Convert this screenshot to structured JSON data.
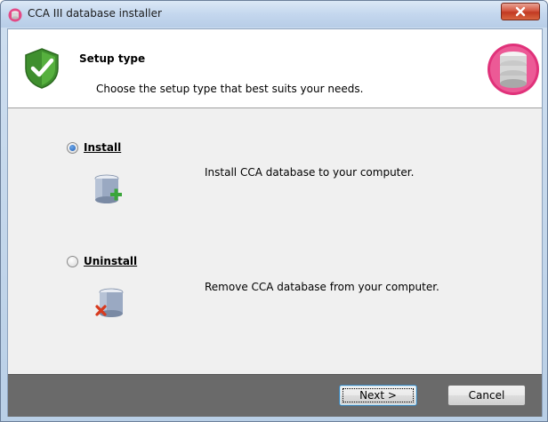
{
  "window": {
    "title": "CCA III database installer",
    "icons": {
      "app": "database-app-icon",
      "close": "close-icon"
    }
  },
  "header": {
    "title": "Setup type",
    "description": "Choose the setup type that best suits your needs.",
    "icons": {
      "left": "green-shield-check-icon",
      "right": "database-logo-icon"
    }
  },
  "options": [
    {
      "label": "Install",
      "mnemonic": "I",
      "description": "Install CCA database to your computer.",
      "selected": true,
      "icon": "database-add-icon"
    },
    {
      "label": "Uninstall",
      "mnemonic": "U",
      "description": "Remove CCA database from your computer.",
      "selected": false,
      "icon": "database-remove-icon"
    }
  ],
  "footer": {
    "next_label": "Next >",
    "cancel_label": "Cancel"
  },
  "colors": {
    "footer_bg": "#6a6a6a",
    "close_button": "#c23a22",
    "accent": "#3c7fb1"
  }
}
